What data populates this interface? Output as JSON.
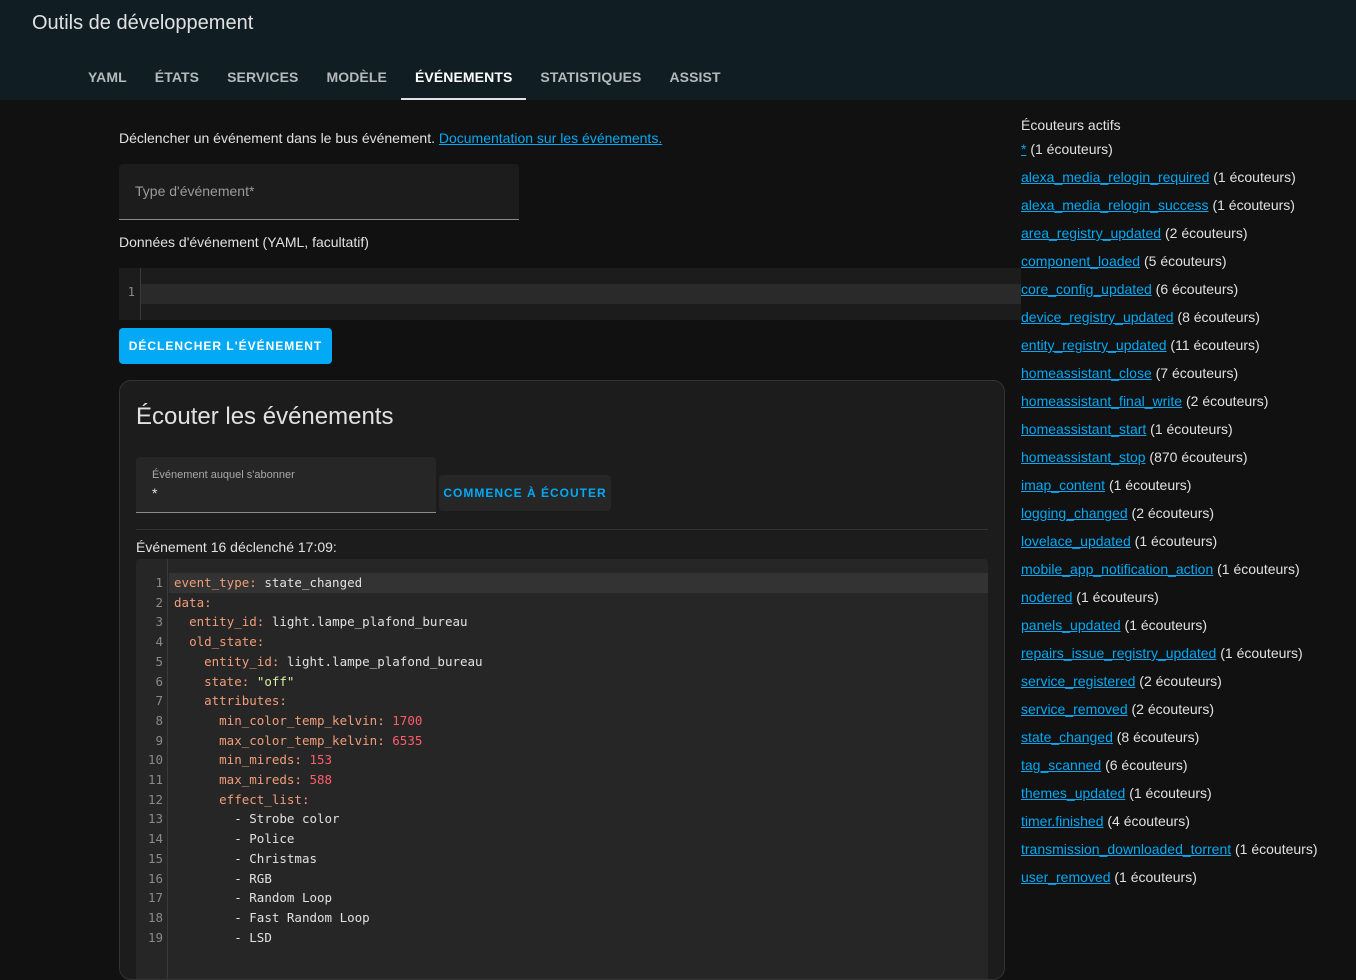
{
  "header": {
    "title": "Outils de développement",
    "tabs": [
      {
        "label": "YAML"
      },
      {
        "label": "ÉTATS"
      },
      {
        "label": "SERVICES"
      },
      {
        "label": "MODÈLE"
      },
      {
        "label": "ÉVÉNEMENTS"
      },
      {
        "label": "STATISTIQUES"
      },
      {
        "label": "ASSIST"
      }
    ],
    "active_tab": "ÉVÉNEMENTS"
  },
  "fire": {
    "intro_text": "Déclencher un événement dans le bus événement. ",
    "doc_link": "Documentation sur les événements.",
    "event_type_label": "Type d'événement*",
    "data_label": "Données d'événement (YAML, facultatif)",
    "line_number": "1",
    "button_label": "DÉCLENCHER L'ÉVÉNEMENT"
  },
  "listen": {
    "title": "Écouter les événements",
    "field_label": "Événement auquel s'abonner",
    "field_value": "*",
    "button_label": "COMMENCE À ÉCOUTER",
    "event_heading": "Événement 16 déclenché 17:09:",
    "code_lines": [
      {
        "n": "1",
        "indent": "",
        "key": "event_type",
        "sep": ": ",
        "val": "state_changed",
        "vt": "plain"
      },
      {
        "n": "2",
        "indent": "",
        "key": "data",
        "sep": ":",
        "val": "",
        "vt": "plain"
      },
      {
        "n": "3",
        "indent": "  ",
        "key": "entity_id",
        "sep": ": ",
        "val": "light.lampe_plafond_bureau",
        "vt": "plain"
      },
      {
        "n": "4",
        "indent": "  ",
        "key": "old_state",
        "sep": ":",
        "val": "",
        "vt": "plain"
      },
      {
        "n": "5",
        "indent": "    ",
        "key": "entity_id",
        "sep": ": ",
        "val": "light.lampe_plafond_bureau",
        "vt": "plain"
      },
      {
        "n": "6",
        "indent": "    ",
        "key": "state",
        "sep": ": ",
        "val": "\"off\"",
        "vt": "str"
      },
      {
        "n": "7",
        "indent": "    ",
        "key": "attributes",
        "sep": ":",
        "val": "",
        "vt": "plain"
      },
      {
        "n": "8",
        "indent": "      ",
        "key": "min_color_temp_kelvin",
        "sep": ": ",
        "val": "1700",
        "vt": "num"
      },
      {
        "n": "9",
        "indent": "      ",
        "key": "max_color_temp_kelvin",
        "sep": ": ",
        "val": "6535",
        "vt": "num"
      },
      {
        "n": "10",
        "indent": "      ",
        "key": "min_mireds",
        "sep": ": ",
        "val": "153",
        "vt": "num"
      },
      {
        "n": "11",
        "indent": "      ",
        "key": "max_mireds",
        "sep": ": ",
        "val": "588",
        "vt": "num"
      },
      {
        "n": "12",
        "indent": "      ",
        "key": "effect_list",
        "sep": ":",
        "val": "",
        "vt": "plain"
      },
      {
        "n": "13",
        "indent": "        ",
        "key": "",
        "sep": "",
        "val": "- Strobe color",
        "vt": "plain"
      },
      {
        "n": "14",
        "indent": "        ",
        "key": "",
        "sep": "",
        "val": "- Police",
        "vt": "plain"
      },
      {
        "n": "15",
        "indent": "        ",
        "key": "",
        "sep": "",
        "val": "- Christmas",
        "vt": "plain"
      },
      {
        "n": "16",
        "indent": "        ",
        "key": "",
        "sep": "",
        "val": "- RGB",
        "vt": "plain"
      },
      {
        "n": "17",
        "indent": "        ",
        "key": "",
        "sep": "",
        "val": "- Random Loop",
        "vt": "plain"
      },
      {
        "n": "18",
        "indent": "        ",
        "key": "",
        "sep": "",
        "val": "- Fast Random Loop",
        "vt": "plain"
      },
      {
        "n": "19",
        "indent": "        ",
        "key": "",
        "sep": "",
        "val": "- LSD",
        "vt": "plain"
      }
    ]
  },
  "listeners": {
    "title": "Écouteurs actifs",
    "items": [
      {
        "event": "*",
        "count": " (1 écouteurs)"
      },
      {
        "event": "alexa_media_relogin_required",
        "count": " (1 écouteurs)"
      },
      {
        "event": "alexa_media_relogin_success",
        "count": " (1 écouteurs)"
      },
      {
        "event": "area_registry_updated",
        "count": " (2 écouteurs)"
      },
      {
        "event": "component_loaded",
        "count": " (5 écouteurs)"
      },
      {
        "event": "core_config_updated",
        "count": " (6 écouteurs)"
      },
      {
        "event": "device_registry_updated",
        "count": " (8 écouteurs)"
      },
      {
        "event": "entity_registry_updated",
        "count": " (11 écouteurs)"
      },
      {
        "event": "homeassistant_close",
        "count": " (7 écouteurs)"
      },
      {
        "event": "homeassistant_final_write",
        "count": " (2 écouteurs)"
      },
      {
        "event": "homeassistant_start",
        "count": " (1 écouteurs)"
      },
      {
        "event": "homeassistant_stop",
        "count": " (870 écouteurs)"
      },
      {
        "event": "imap_content",
        "count": " (1 écouteurs)"
      },
      {
        "event": "logging_changed",
        "count": " (2 écouteurs)"
      },
      {
        "event": "lovelace_updated",
        "count": " (1 écouteurs)"
      },
      {
        "event": "mobile_app_notification_action",
        "count": " (1 écouteurs)"
      },
      {
        "event": "nodered",
        "count": " (1 écouteurs)"
      },
      {
        "event": "panels_updated",
        "count": " (1 écouteurs)"
      },
      {
        "event": "repairs_issue_registry_updated",
        "count": " (1 écouteurs)"
      },
      {
        "event": "service_registered",
        "count": " (2 écouteurs)"
      },
      {
        "event": "service_removed",
        "count": " (2 écouteurs)"
      },
      {
        "event": "state_changed",
        "count": " (8 écouteurs)"
      },
      {
        "event": "tag_scanned",
        "count": " (6 écouteurs)"
      },
      {
        "event": "themes_updated",
        "count": " (1 écouteurs)"
      },
      {
        "event": "timer.finished",
        "count": " (4 écouteurs)"
      },
      {
        "event": "transmission_downloaded_torrent",
        "count": " (1 écouteurs)"
      },
      {
        "event": "user_removed",
        "count": " (1 écouteurs)"
      }
    ]
  },
  "colors": {
    "accent": "#03a9f4",
    "header_bg": "#101e24",
    "page_bg": "#111111",
    "yaml_key": "#f29d78",
    "yaml_number": "#ff5b6a",
    "yaml_string": "#d6f5a0"
  }
}
